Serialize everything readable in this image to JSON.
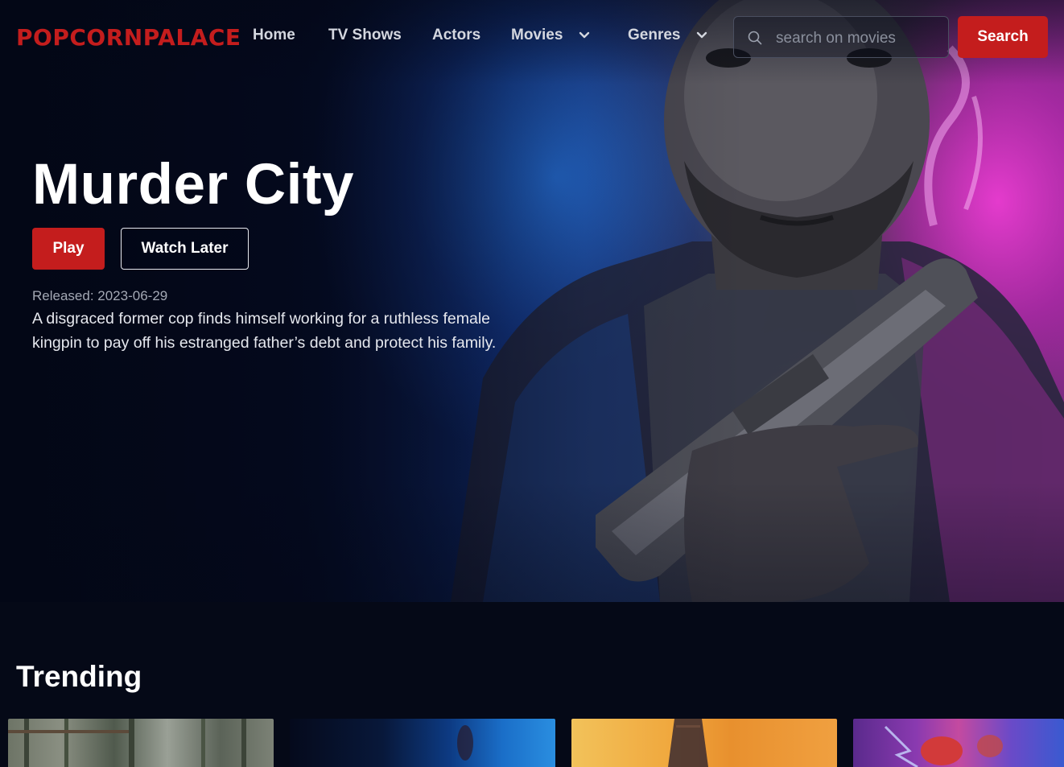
{
  "nav": {
    "logo": "POPCORNPALACE",
    "links": [
      {
        "label": "Home"
      },
      {
        "label": "TV Shows"
      },
      {
        "label": "Actors"
      },
      {
        "label": "Movies",
        "dropdown": true
      },
      {
        "label": "Genres",
        "dropdown": true
      }
    ],
    "search": {
      "placeholder": "search on movies",
      "value": "",
      "button_label": "Search",
      "icon": "search-icon"
    }
  },
  "hero": {
    "title": "Murder City",
    "play_label": "Play",
    "watch_later_label": "Watch Later",
    "released": "Released: 2023-06-29",
    "overview": "A disgraced former cop finds himself working for a ruthless female kingpin to pay off his estranged father’s debt and protect his family."
  },
  "trending": {
    "title": "Trending",
    "cards": [
      {
        "name": "trending-card-1"
      },
      {
        "name": "trending-card-2"
      },
      {
        "name": "trending-card-3"
      },
      {
        "name": "trending-card-4"
      }
    ]
  },
  "colors": {
    "brand": "#c41d1d",
    "background": "#050917",
    "nav_text": "#d4d7df",
    "muted_text": "#a3a8b4"
  }
}
